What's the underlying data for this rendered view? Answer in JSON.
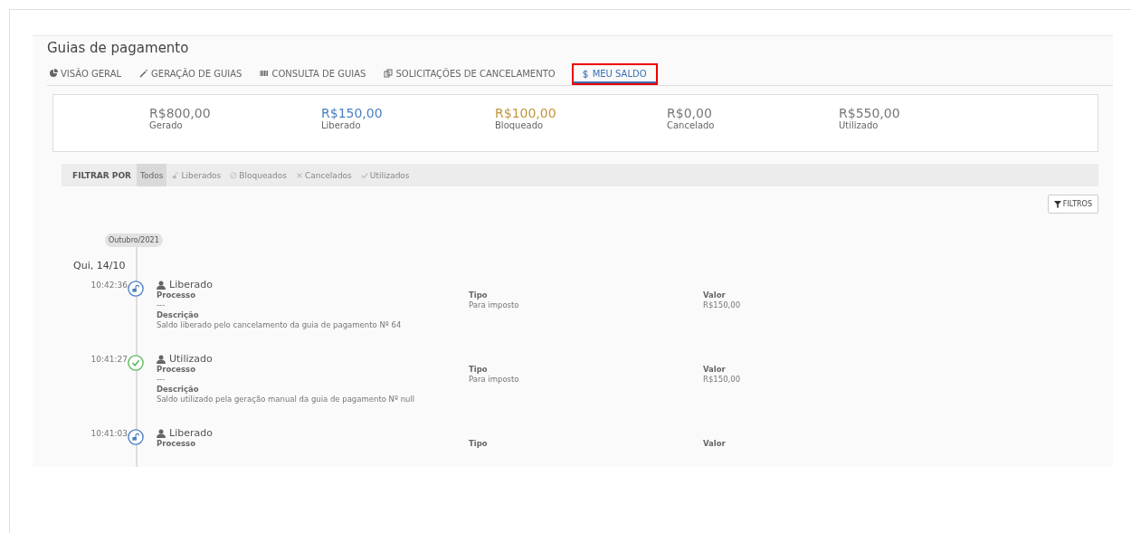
{
  "title": "Guias de pagamento",
  "tabs": [
    {
      "label": "VISÃO GERAL",
      "kind": "pie",
      "selected": false
    },
    {
      "label": "GERAÇÃO DE GUIAS",
      "kind": "wand",
      "selected": false
    },
    {
      "label": "CONSULTA DE GUIAS",
      "kind": "barcode",
      "selected": false
    },
    {
      "label": "SOLICITAÇÕES DE CANCELAMENTO",
      "kind": "copy",
      "selected": false
    },
    {
      "label": "MEU SALDO",
      "kind": "dollar",
      "selected": true
    }
  ],
  "summary": [
    {
      "amount": "R$800,00",
      "label": "Gerado",
      "color": "#777777"
    },
    {
      "amount": "R$150,00",
      "label": "Liberado",
      "color": "#4a7fc1"
    },
    {
      "amount": "R$100,00",
      "label": "Bloqueado",
      "color": "#c0963a"
    },
    {
      "amount": "R$0,00",
      "label": "Cancelado",
      "color": "#777777"
    },
    {
      "amount": "R$550,00",
      "label": "Utilizado",
      "color": "#777777"
    }
  ],
  "filter": {
    "label": "FILTRAR POR",
    "options": [
      {
        "label": "Todos",
        "kind": "none",
        "selected": true
      },
      {
        "label": "Liberados",
        "kind": "unlock",
        "selected": false
      },
      {
        "label": "Bloqueados",
        "kind": "ban",
        "selected": false
      },
      {
        "label": "Cancelados",
        "kind": "x",
        "selected": false
      },
      {
        "label": "Utilizados",
        "kind": "check",
        "selected": false
      }
    ]
  },
  "filters_button": "FILTROS",
  "month": "Outubro/2021",
  "day": "Qui, 14/10",
  "entries": [
    {
      "time": "10:42:36",
      "kind": "liberado",
      "title": "Liberado",
      "fields": [
        {
          "label": "Processo",
          "value": "---"
        },
        {
          "label": "Tipo",
          "value": "Para imposto"
        },
        {
          "label": "Valor",
          "value": "R$150,00"
        }
      ],
      "description_label": "Descrição",
      "description": "Saldo liberado pelo cancelamento da guia de pagamento Nº 64"
    },
    {
      "time": "10:41:27",
      "kind": "utilizado",
      "title": "Utilizado",
      "fields": [
        {
          "label": "Processo",
          "value": "---"
        },
        {
          "label": "Tipo",
          "value": "Para imposto"
        },
        {
          "label": "Valor",
          "value": "R$150,00"
        }
      ],
      "description_label": "Descrição",
      "description": "Saldo utilizado pela geração manual da guia de pagamento Nº null"
    },
    {
      "time": "10:41:03",
      "kind": "liberado",
      "title": "Liberado",
      "fields": [
        {
          "label": "Processo"
        },
        {
          "label": "Tipo"
        },
        {
          "label": "Valor"
        }
      ]
    }
  ]
}
